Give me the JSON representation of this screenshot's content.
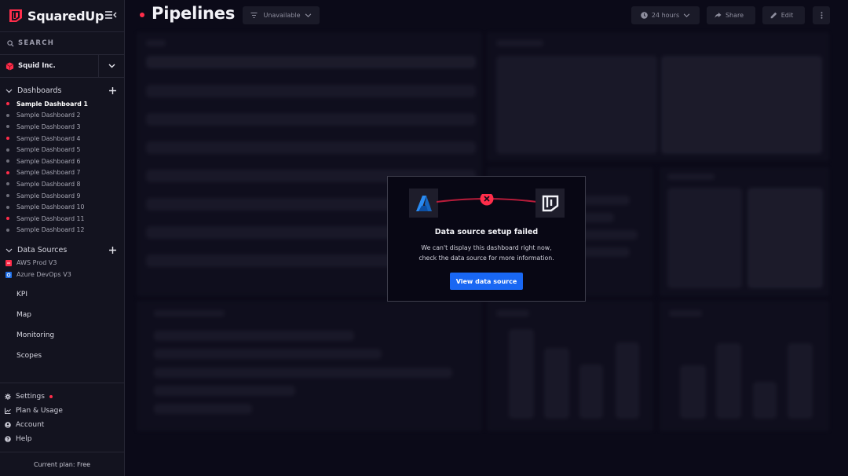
{
  "app": {
    "brand": "SquaredUp",
    "brand_color": "#ff2d4a"
  },
  "sidebar": {
    "search_label": "SEARCH",
    "org_name": "Squid Inc.",
    "dashboards": {
      "title": "Dashboards",
      "items": [
        {
          "label": "Sample Dashboard 1",
          "status": "error",
          "active": true
        },
        {
          "label": "Sample Dashboard 2",
          "status": "neutral"
        },
        {
          "label": "Sample Dashboard 3",
          "status": "neutral"
        },
        {
          "label": "Sample Dashboard 4",
          "status": "error"
        },
        {
          "label": "Sample Dashboard 5",
          "status": "neutral"
        },
        {
          "label": "Sample Dashboard 6",
          "status": "neutral"
        },
        {
          "label": "Sample Dashboard 7",
          "status": "error"
        },
        {
          "label": "Sample Dashboard 8",
          "status": "neutral"
        },
        {
          "label": "Sample Dashboard 9",
          "status": "neutral"
        },
        {
          "label": "Sample Dashboard 10",
          "status": "neutral"
        },
        {
          "label": "Sample Dashboard 11",
          "status": "error"
        },
        {
          "label": "Sample Dashboard 12",
          "status": "neutral"
        }
      ]
    },
    "data_sources": {
      "title": "Data Sources",
      "items": [
        {
          "label": "AWS Prod V3",
          "icon": "aws-icon",
          "color": "#ff2d4a"
        },
        {
          "label": "Azure DevOps V3",
          "icon": "azure-devops-icon",
          "color": "#1f6fe8"
        }
      ]
    },
    "nav": [
      "KPI",
      "Map",
      "Monitoring",
      "Scopes"
    ],
    "bottom": [
      {
        "label": "Settings",
        "icon": "gear-icon",
        "alert": true
      },
      {
        "label": "Plan & Usage",
        "icon": "chart-icon"
      },
      {
        "label": "Account",
        "icon": "user-icon"
      },
      {
        "label": "Help",
        "icon": "help-icon"
      }
    ],
    "plan_text": "Current plan: Free"
  },
  "header": {
    "title": "Pipelines",
    "status": "error",
    "scope_filter": "Unavailable",
    "timeframe": "24 hours",
    "share_label": "Share",
    "edit_label": "Edit"
  },
  "modal": {
    "title": "Data source setup failed",
    "body_line1": "We can't display this dashboard right now,",
    "body_line2": "check the data source for more information.",
    "button_label": "View data source",
    "button_color": "#1967f3",
    "error_color": "#ff2d4a"
  }
}
